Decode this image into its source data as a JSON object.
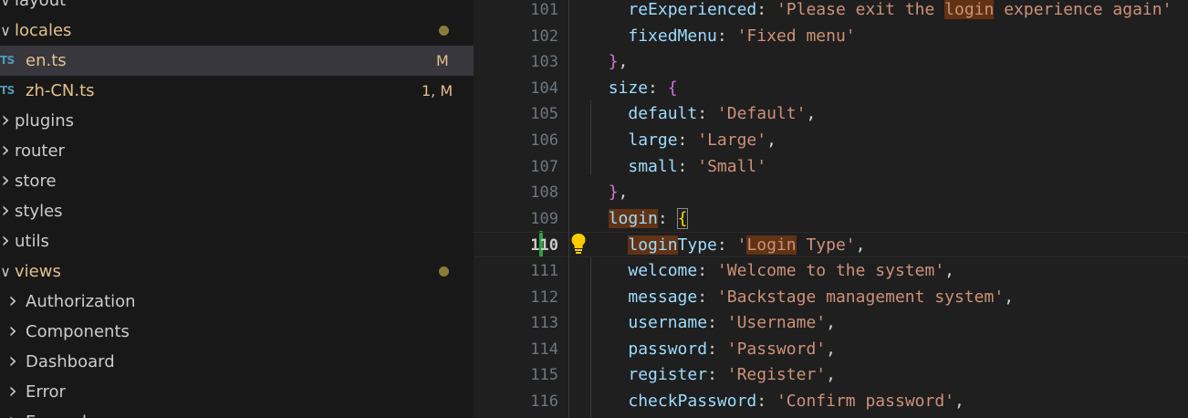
{
  "explorer": {
    "items": [
      {
        "label": "layout",
        "chevron": "down",
        "indent": 1,
        "modified": false,
        "partial": true
      },
      {
        "label": "locales",
        "chevron": "down",
        "indent": 1,
        "modified": true,
        "dot": true
      },
      {
        "label": "en.ts",
        "icon": "TS",
        "indent": 2,
        "modified": true,
        "badge": "M",
        "selected": true
      },
      {
        "label": "zh-CN.ts",
        "icon": "TS",
        "indent": 2,
        "modified": true,
        "badge": "1, M"
      },
      {
        "label": "plugins",
        "chevron": "right",
        "indent": 1
      },
      {
        "label": "router",
        "chevron": "right",
        "indent": 1
      },
      {
        "label": "store",
        "chevron": "right",
        "indent": 1
      },
      {
        "label": "styles",
        "chevron": "right",
        "indent": 1
      },
      {
        "label": "utils",
        "chevron": "right",
        "indent": 1
      },
      {
        "label": "views",
        "chevron": "down",
        "indent": 1,
        "modified": true,
        "dot": true
      },
      {
        "label": "Authorization",
        "chevron": "right",
        "indent": 2
      },
      {
        "label": "Components",
        "chevron": "right",
        "indent": 2
      },
      {
        "label": "Dashboard",
        "chevron": "right",
        "indent": 2
      },
      {
        "label": "Error",
        "chevron": "right",
        "indent": 2
      },
      {
        "label": "Example",
        "chevron": "right",
        "indent": 2,
        "partial": true
      }
    ]
  },
  "editor": {
    "current_line": 110,
    "lines": [
      {
        "n": "101",
        "tokens": [
          [
            "ind",
            "    "
          ],
          [
            "key",
            "reExperienced"
          ],
          [
            "pun",
            ": "
          ],
          [
            "str",
            "'Please exit the "
          ],
          [
            "strhl",
            "login"
          ],
          [
            "str",
            " experience again'"
          ]
        ]
      },
      {
        "n": "102",
        "tokens": [
          [
            "ind",
            "    "
          ],
          [
            "key",
            "fixedMenu"
          ],
          [
            "pun",
            ": "
          ],
          [
            "str",
            "'Fixed menu'"
          ]
        ]
      },
      {
        "n": "103",
        "tokens": [
          [
            "ind",
            "  "
          ],
          [
            "brace1",
            "}"
          ],
          [
            "pun",
            ","
          ]
        ]
      },
      {
        "n": "104",
        "tokens": [
          [
            "ind",
            "  "
          ],
          [
            "key",
            "size"
          ],
          [
            "pun",
            ": "
          ],
          [
            "brace1",
            "{"
          ]
        ]
      },
      {
        "n": "105",
        "tokens": [
          [
            "ind",
            "    "
          ],
          [
            "key",
            "default"
          ],
          [
            "pun",
            ": "
          ],
          [
            "str",
            "'Default'"
          ],
          [
            "pun",
            ","
          ]
        ]
      },
      {
        "n": "106",
        "tokens": [
          [
            "ind",
            "    "
          ],
          [
            "key",
            "large"
          ],
          [
            "pun",
            ": "
          ],
          [
            "str",
            "'Large'"
          ],
          [
            "pun",
            ","
          ]
        ]
      },
      {
        "n": "107",
        "tokens": [
          [
            "ind",
            "    "
          ],
          [
            "key",
            "small"
          ],
          [
            "pun",
            ": "
          ],
          [
            "str",
            "'Small'"
          ]
        ]
      },
      {
        "n": "108",
        "tokens": [
          [
            "ind",
            "  "
          ],
          [
            "brace1",
            "}"
          ],
          [
            "pun",
            ","
          ]
        ]
      },
      {
        "n": "109",
        "tokens": [
          [
            "ind",
            "  "
          ],
          [
            "keyhl",
            "login"
          ],
          [
            "pun",
            ": "
          ],
          [
            "brace1box",
            "{"
          ]
        ]
      },
      {
        "n": "110",
        "tokens": [
          [
            "ind",
            "    "
          ],
          [
            "keyhl",
            "login"
          ],
          [
            "key",
            "Type"
          ],
          [
            "pun",
            ": "
          ],
          [
            "str",
            "'"
          ],
          [
            "strhl",
            "Login"
          ],
          [
            "str",
            " Type'"
          ],
          [
            "pun",
            ","
          ]
        ]
      },
      {
        "n": "111",
        "tokens": [
          [
            "ind",
            "    "
          ],
          [
            "key",
            "welcome"
          ],
          [
            "pun",
            ": "
          ],
          [
            "str",
            "'Welcome to the system'"
          ],
          [
            "pun",
            ","
          ]
        ]
      },
      {
        "n": "112",
        "tokens": [
          [
            "ind",
            "    "
          ],
          [
            "key",
            "message"
          ],
          [
            "pun",
            ": "
          ],
          [
            "str",
            "'Backstage management system'"
          ],
          [
            "pun",
            ","
          ]
        ]
      },
      {
        "n": "113",
        "tokens": [
          [
            "ind",
            "    "
          ],
          [
            "key",
            "username"
          ],
          [
            "pun",
            ": "
          ],
          [
            "str",
            "'Username'"
          ],
          [
            "pun",
            ","
          ]
        ]
      },
      {
        "n": "114",
        "tokens": [
          [
            "ind",
            "    "
          ],
          [
            "key",
            "password"
          ],
          [
            "pun",
            ": "
          ],
          [
            "str",
            "'Password'"
          ],
          [
            "pun",
            ","
          ]
        ]
      },
      {
        "n": "115",
        "tokens": [
          [
            "ind",
            "    "
          ],
          [
            "key",
            "register"
          ],
          [
            "pun",
            ": "
          ],
          [
            "str",
            "'Register'"
          ],
          [
            "pun",
            ","
          ]
        ]
      },
      {
        "n": "116",
        "tokens": [
          [
            "ind",
            "    "
          ],
          [
            "key",
            "checkPassword"
          ],
          [
            "pun",
            ": "
          ],
          [
            "str",
            "'Confirm password'"
          ],
          [
            "pun",
            ","
          ]
        ]
      }
    ],
    "icons": {
      "lightbulb": "lightbulb-icon"
    }
  }
}
